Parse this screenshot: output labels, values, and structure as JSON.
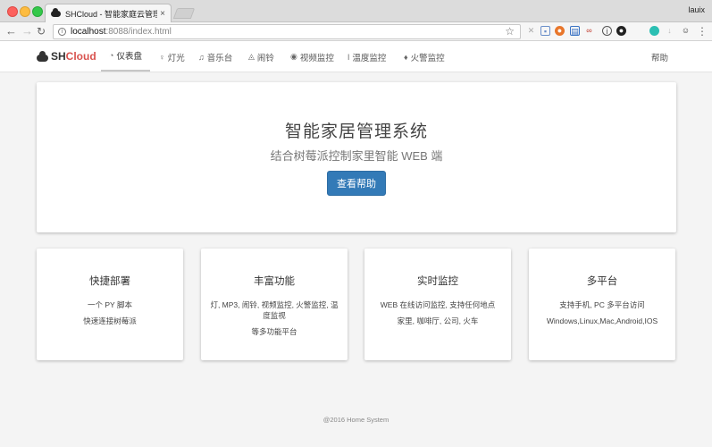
{
  "browser": {
    "tab_title": "SHCloud - 智能家庭云管理系统",
    "tab_close": "×",
    "user": "lauix",
    "url_host": "localhost",
    "url_rest": ":8088/index.html",
    "star": "☆",
    "back": "←",
    "forward": "→",
    "reload": "↻",
    "menu": "⋮"
  },
  "navbar": {
    "brand_sh": "SH",
    "brand_cloud": "Cloud",
    "items": [
      {
        "label": "仪表盘",
        "icon": "dashboard-icon",
        "glyph": "◔"
      },
      {
        "label": "灯光",
        "icon": "lightbulb-icon",
        "glyph": "♀"
      },
      {
        "label": "音乐台",
        "icon": "music-icon",
        "glyph": "♫"
      },
      {
        "label": "闹铃",
        "icon": "bell-icon",
        "glyph": "◬"
      },
      {
        "label": "视频监控",
        "icon": "eye-icon",
        "glyph": "◉"
      },
      {
        "label": "温度监控",
        "icon": "thermometer-icon",
        "glyph": "ǀ"
      },
      {
        "label": "火警监控",
        "icon": "fire-icon",
        "glyph": "♦"
      }
    ],
    "help": "帮助"
  },
  "jumbotron": {
    "title": "智能家居管理系统",
    "subtitle": "结合树莓派控制家里智能 WEB 端",
    "button": "查看帮助"
  },
  "cards": [
    {
      "title": "快捷部署",
      "lines": [
        "一个 PY 脚本",
        "快速连接树莓派"
      ]
    },
    {
      "title": "丰富功能",
      "lines": [
        "灯, MP3, 闹铃, 视频监控, 火警监控, 温度监视",
        "等多功能平台"
      ]
    },
    {
      "title": "实时监控",
      "lines": [
        "WEB 在线访问监控, 支持任何地点",
        "家里, 咖啡厅, 公司, 火车"
      ]
    },
    {
      "title": "多平台",
      "lines": [
        "支持手机, PC 多平台访问",
        "Windows,Linux,Mac,Android,IOS"
      ]
    }
  ],
  "footer": "@2016 Home System"
}
